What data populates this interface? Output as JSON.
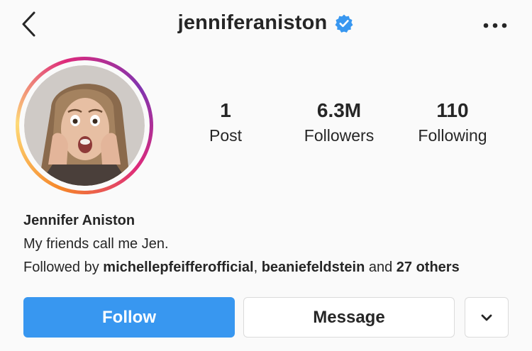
{
  "header": {
    "username": "jenniferaniston",
    "verified": true,
    "back_icon": "chevron-left-icon",
    "more_icon": "ellipsis-icon"
  },
  "profile": {
    "avatar_icon": "profile-photo",
    "ring_colors": [
      "#f58529",
      "#dd2a7b",
      "#8134af"
    ]
  },
  "stats": [
    {
      "value": "1",
      "label": "Post"
    },
    {
      "value": "6.3M",
      "label": "Followers"
    },
    {
      "value": "110",
      "label": "Following"
    }
  ],
  "bio": {
    "name": "Jennifer Aniston",
    "text": "My friends call me Jen.",
    "followed_prefix": "Followed by ",
    "followed_user1": "michellepfeifferofficial",
    "followed_sep": ", ",
    "followed_user2": "beaniefeldstein",
    "followed_and": " and ",
    "followed_others": "27 others"
  },
  "actions": {
    "follow_label": "Follow",
    "message_label": "Message",
    "dropdown_icon": "chevron-down-icon"
  },
  "colors": {
    "accent": "#3897f0",
    "text": "#262626",
    "background": "#fafafa",
    "border": "#dbdbdb"
  }
}
